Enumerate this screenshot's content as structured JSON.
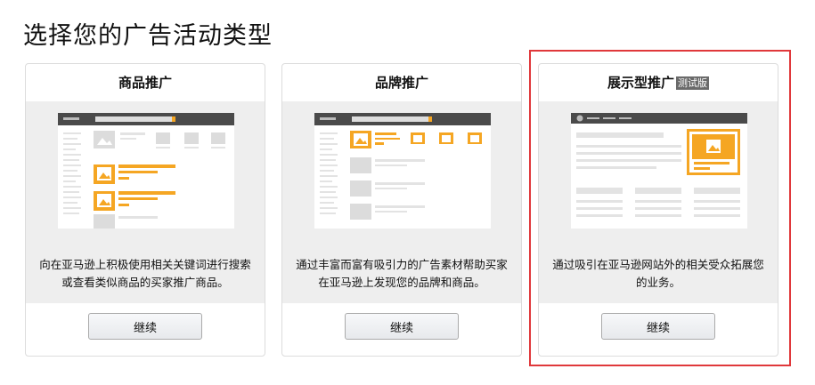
{
  "page": {
    "title": "选择您的广告活动类型"
  },
  "cards": [
    {
      "title": "商品推广",
      "description": "向在亚马逊上积极使用相关关键词进行搜索或查看类似商品的买家推广商品。",
      "button_label": "继续"
    },
    {
      "title": "品牌推广",
      "description": "通过丰富而富有吸引力的广告素材帮助买家在亚马逊上发现您的品牌和商品。",
      "button_label": "继续"
    },
    {
      "title": "展示型推广",
      "badge": "测试版",
      "description": "通过吸引在亚马逊网站外的相关受众拓展您的业务。",
      "button_label": "继续"
    }
  ],
  "colors": {
    "accent_orange": "#f5a623",
    "highlight_red": "#e0383b",
    "mock_header": "#4a4a4a"
  }
}
